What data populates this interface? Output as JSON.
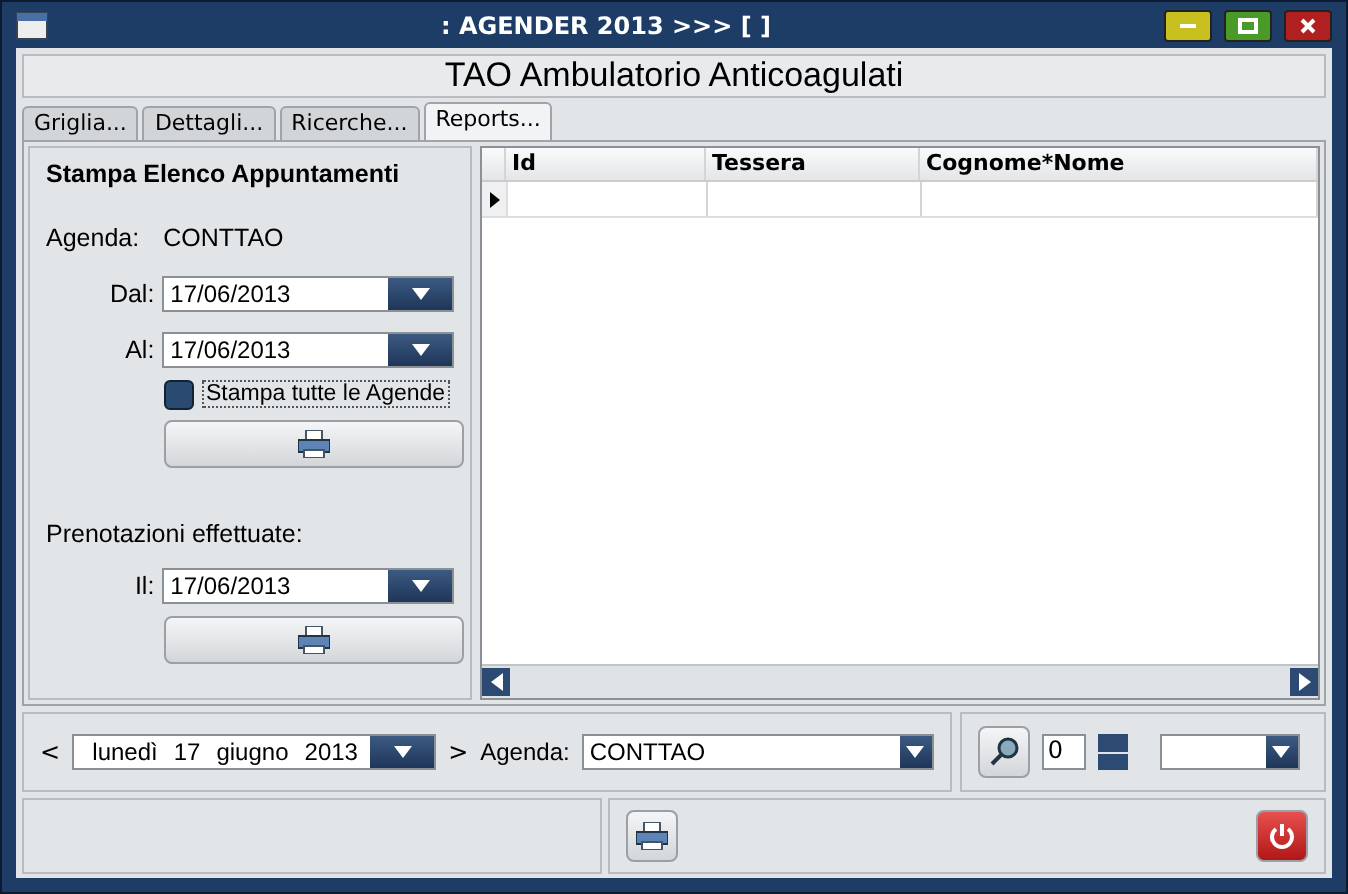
{
  "window": {
    "title": ": AGENDER 2013   >>> [  ]"
  },
  "header": "TAO Ambulatorio Anticoagulati",
  "tabs": [
    {
      "label": "Griglia...",
      "selected": false
    },
    {
      "label": "Dettagli...",
      "selected": false
    },
    {
      "label": "Ricerche...",
      "selected": false
    },
    {
      "label": "Reports...",
      "selected": true
    }
  ],
  "report_panel": {
    "title": "Stampa Elenco Appuntamenti",
    "agenda_label": "Agenda:",
    "agenda_value": "CONTTAO",
    "from": {
      "label": "Dal:",
      "value": "17/06/2013"
    },
    "to": {
      "label": "Al:",
      "value": "17/06/2013"
    },
    "all_agendas": {
      "label": "Stampa tutte le Agende",
      "checked": false
    },
    "section": "Prenotazioni effettuate:",
    "booked": {
      "label": "Il:",
      "value": "17/06/2013"
    }
  },
  "grid": {
    "columns": [
      "Id",
      "Tessera",
      "Cognome*Nome"
    ],
    "rows": [
      {
        "current": true
      }
    ]
  },
  "navigator": {
    "prev": "<",
    "date_parts": [
      "lunedì",
      "17",
      "giugno",
      "2013"
    ],
    "next": ">",
    "agenda_label": "Agenda:",
    "agenda_value": "CONTTAO",
    "counter": "0"
  }
}
